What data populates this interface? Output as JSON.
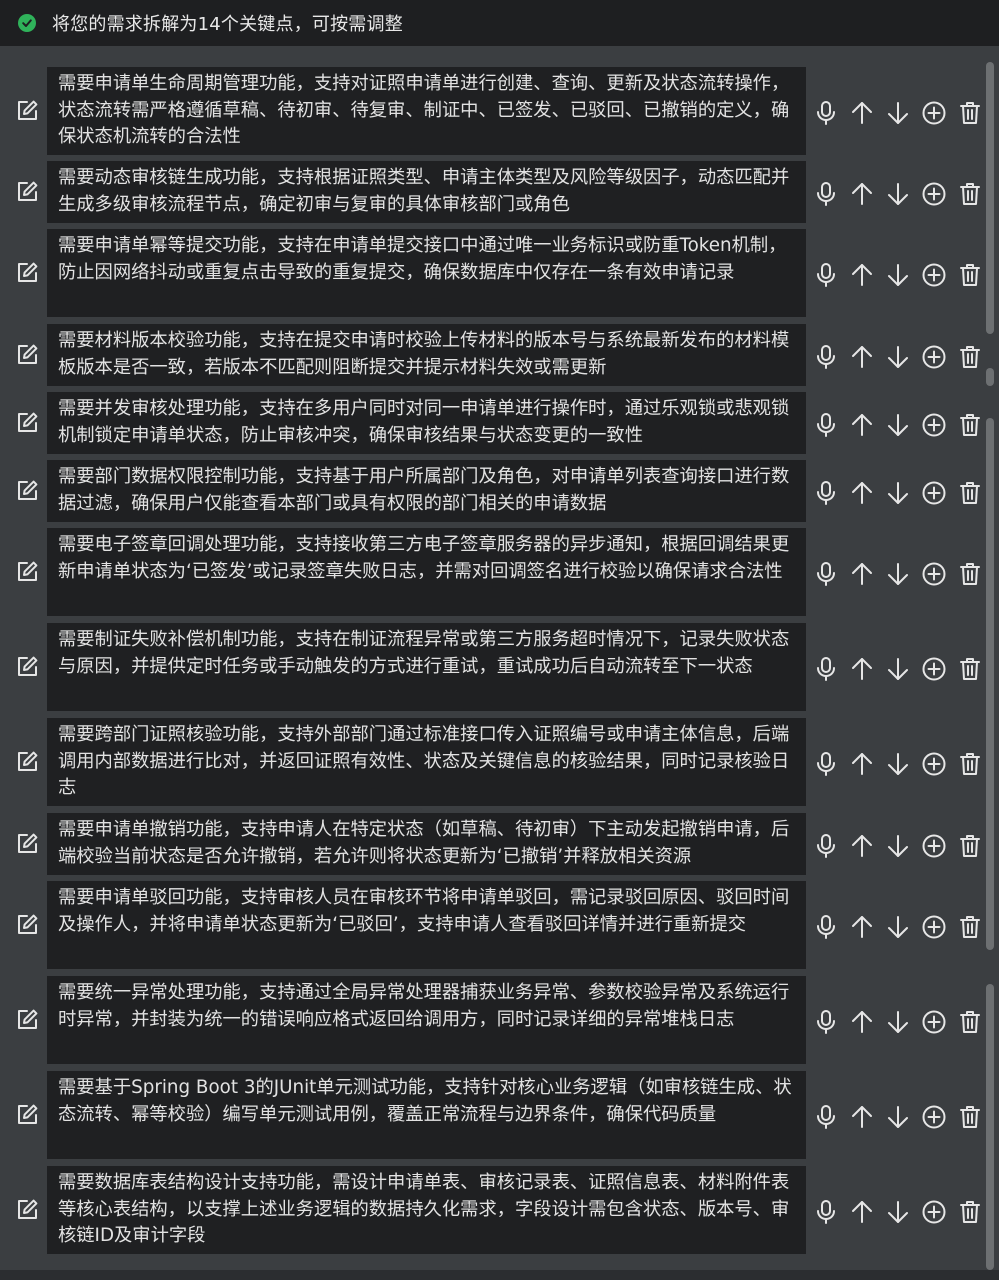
{
  "header": {
    "status_icon": "check-circle-icon",
    "status_color": "#2fb25a",
    "title": "将您的需求拆解为14个关键点，可按需调整"
  },
  "colors": {
    "background": "#3b3e41",
    "item_background": "#1f2022",
    "text": "#e2e2e2",
    "icon": "#e6e6e6"
  },
  "items": [
    {
      "text": "需要申请单生命周期管理功能，支持对证照申请单进行创建、查询、更新及状态流转操作，状态流转需严格遵循草稿、待初审、待复审、制证中、已签发、已驳回、已撤销的定义，确保状态机流转的合法性"
    },
    {
      "text": "需要动态审核链生成功能，支持根据证照类型、申请主体类型及风险等级因子，动态匹配并生成多级审核流程节点，确定初审与复审的具体审核部门或角色"
    },
    {
      "text": "需要申请单幂等提交功能，支持在申请单提交接口中通过唯一业务标识或防重Token机制，防止因网络抖动或重复点击导致的重复提交，确保数据库中仅存在一条有效申请记录"
    },
    {
      "text": "需要材料版本校验功能，支持在提交申请时校验上传材料的版本号与系统最新发布的材料模板版本是否一致，若版本不匹配则阻断提交并提示材料失效或需更新"
    },
    {
      "text": "需要并发审核处理功能，支持在多用户同时对同一申请单进行操作时，通过乐观锁或悲观锁机制锁定申请单状态，防止审核冲突，确保审核结果与状态变更的一致性"
    },
    {
      "text": "需要部门数据权限控制功能，支持基于用户所属部门及角色，对申请单列表查询接口进行数据过滤，确保用户仅能查看本部门或具有权限的部门相关的申请数据"
    },
    {
      "text": "需要电子签章回调处理功能，支持接收第三方电子签章服务器的异步通知，根据回调结果更新申请单状态为‘已签发’或记录签章失败日志，并需对回调签名进行校验以确保请求合法性"
    },
    {
      "text": "需要制证失败补偿机制功能，支持在制证流程异常或第三方服务超时情况下，记录失败状态与原因，并提供定时任务或手动触发的方式进行重试，重试成功后自动流转至下一状态"
    },
    {
      "text": "需要跨部门证照核验功能，支持外部部门通过标准接口传入证照编号或申请主体信息，后端调用内部数据进行比对，并返回证照有效性、状态及关键信息的核验结果，同时记录核验日志"
    },
    {
      "text": "需要申请单撤销功能，支持申请人在特定状态（如草稿、待初审）下主动发起撤销申请，后端校验当前状态是否允许撤销，若允许则将状态更新为‘已撤销’并释放相关资源"
    },
    {
      "text": "需要申请单驳回功能，支持审核人员在审核环节将申请单驳回，需记录驳回原因、驳回时间及操作人，并将申请单状态更新为‘已驳回’，支持申请人查看驳回详情并进行重新提交"
    },
    {
      "text": "需要统一异常处理功能，支持通过全局异常处理器捕获业务异常、参数校验异常及系统运行时异常，并封装为统一的错误响应格式返回给调用方，同时记录详细的异常堆栈日志"
    },
    {
      "text": "需要基于Spring Boot 3的JUnit单元测试功能，支持针对核心业务逻辑（如审核链生成、状态流转、幂等校验）编写单元测试用例，覆盖正常流程与边界条件，确保代码质量"
    },
    {
      "text": "需要数据库表结构设计支持功能，需设计申请单表、审核记录表、证照信息表、材料附件表等核心表结构，以支撑上述业务逻辑的数据持久化需求，字段设计需包含状态、版本号、审核链ID及审计字段"
    }
  ],
  "item_icons": {
    "edit": "edit-icon",
    "actions": [
      "microphone-icon",
      "arrow-up-icon",
      "arrow-down-icon",
      "add-circle-icon",
      "trash-icon"
    ]
  }
}
